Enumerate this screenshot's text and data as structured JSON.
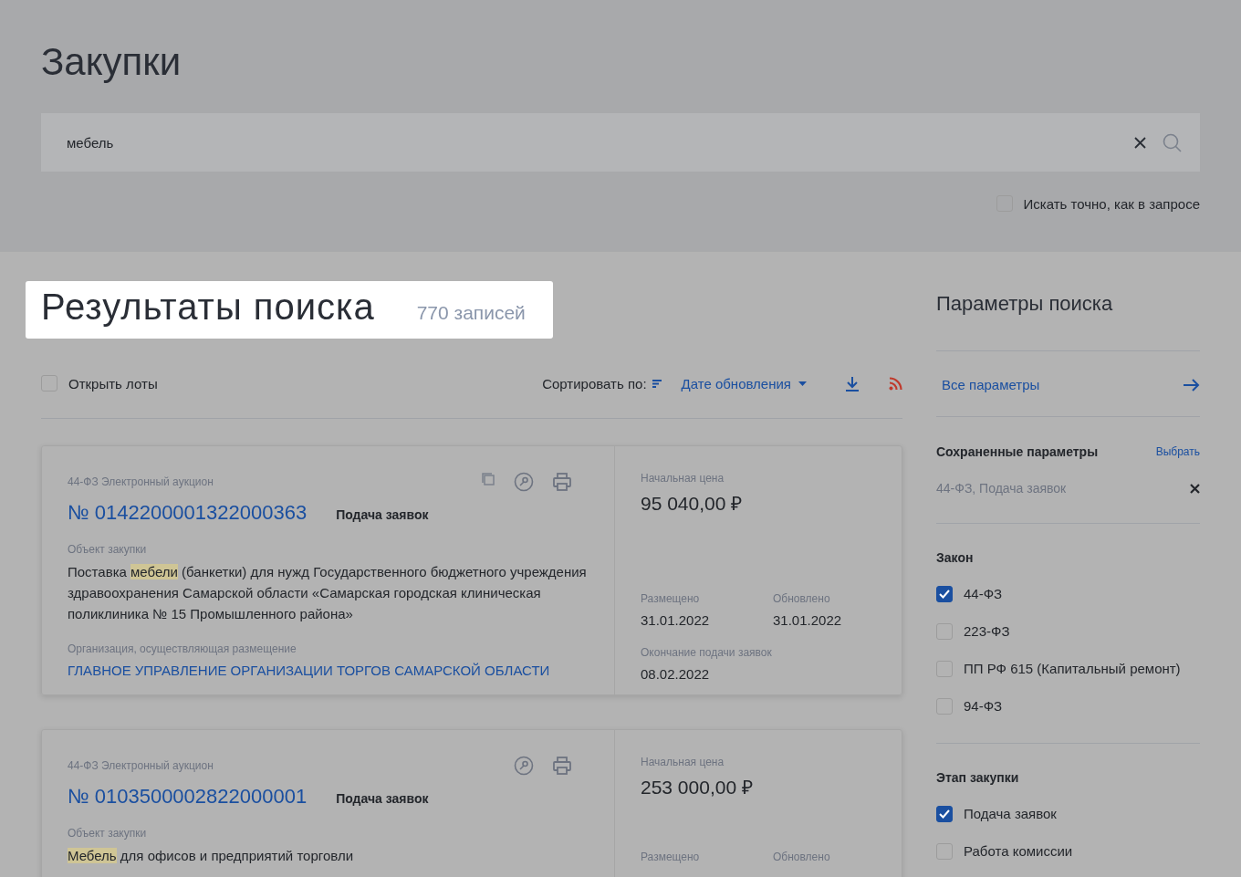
{
  "page_title": "Закупки",
  "search": {
    "value": "мебель",
    "exact_match": {
      "label": "Искать точно, как в запросе",
      "checked": false
    }
  },
  "results": {
    "title": "Результаты поиска",
    "count": "770 записей",
    "open_lots": {
      "label": "Открыть лоты",
      "checked": false
    },
    "sort_label": "Сортировать по:",
    "sort_value": "Дате обновления"
  },
  "cards": [
    {
      "type": "44-ФЗ Электронный аукцион",
      "number": "№ 0142200001322000363",
      "status": "Подача заявок",
      "icons": [
        {
          "kind": "copy"
        },
        {
          "kind": "key"
        },
        {
          "kind": "print"
        }
      ],
      "object_label": "Объект закупки",
      "object": "Поставка **мебели** (банкетки) для нужд Государственного бюджетного учреждения здравоохранения Самарской области «Самарская городская клиническая поликлиника № 15 Промышленного района»",
      "org_label": "Организация, осуществляющая размещение",
      "org": "ГЛАВНОЕ УПРАВЛЕНИЕ ОРГАНИЗАЦИИ ТОРГОВ САМАРСКОЙ ОБЛАСТИ",
      "price_label": "Начальная цена",
      "price": "95 040,00 ₽",
      "posted_label": "Размещено",
      "posted": "31.01.2022",
      "updated_label": "Обновлено",
      "updated": "31.01.2022",
      "deadline_label": "Окончание подачи заявок",
      "deadline": "08.02.2022"
    },
    {
      "type": "44-ФЗ Электронный аукцион",
      "number": "№ 0103500002822000001",
      "status": "Подача заявок",
      "icons": [
        {
          "kind": "key"
        },
        {
          "kind": "print"
        }
      ],
      "object_label": "Объект закупки",
      "object": "**Мебель** для офисов и предприятий торговли",
      "price_label": "Начальная цена",
      "price": "253 000,00 ₽",
      "posted_label": "Размещено",
      "updated_label": "Обновлено"
    }
  ],
  "sidebar": {
    "title": "Параметры поиска",
    "all_params": "Все параметры",
    "saved_title": "Сохраненные параметры",
    "saved_action": "Выбрать",
    "saved_value": "44-ФЗ, Подача заявок",
    "groups": [
      {
        "title": "Закон",
        "options": [
          {
            "label": "44-ФЗ",
            "checked": true
          },
          {
            "label": "223-ФЗ",
            "checked": false
          },
          {
            "label": "ПП РФ 615 (Капитальный ремонт)",
            "checked": false
          },
          {
            "label": "94-ФЗ",
            "checked": false
          }
        ]
      },
      {
        "title": "Этап закупки",
        "options": [
          {
            "label": "Подача заявок",
            "checked": true
          },
          {
            "label": "Работа комиссии",
            "checked": false
          }
        ]
      }
    ]
  }
}
